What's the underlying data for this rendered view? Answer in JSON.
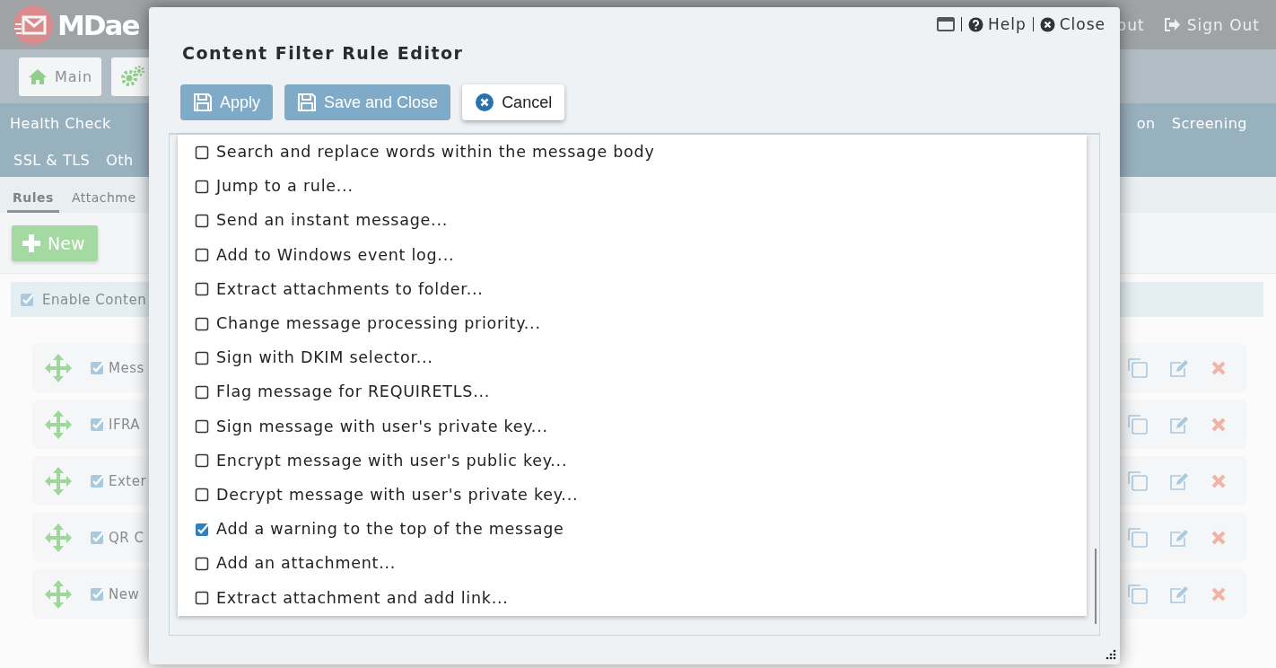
{
  "app_header": {
    "logo_text": "MDae",
    "links": [
      {
        "label": "out",
        "kind": "plain"
      },
      {
        "label": "Sign Out",
        "kind": "signout"
      }
    ]
  },
  "toolbar": {
    "buttons": [
      {
        "label": "Main",
        "kind": "home"
      },
      {
        "kind": "settings"
      }
    ]
  },
  "nav": {
    "rows": [
      {
        "left": [
          "Health Check"
        ],
        "right": [
          "on",
          "Screening"
        ]
      },
      {
        "left": [
          "SSL & TLS",
          "Oth"
        ],
        "right": []
      }
    ]
  },
  "subtabs": [
    {
      "label": "Rules",
      "selected": true
    },
    {
      "label": "Attachme",
      "selected": false
    }
  ],
  "new_button": "New",
  "enable_option": {
    "label": "Enable Conten",
    "checked": true
  },
  "rules": [
    {
      "name": "Mess",
      "enabled": true
    },
    {
      "name": "IFRA",
      "enabled": true
    },
    {
      "name": "Exter",
      "enabled": true
    },
    {
      "name": "QR C",
      "enabled": true
    },
    {
      "name": "New",
      "enabled": true
    }
  ],
  "dialog": {
    "title": "Content Filter Rule Editor",
    "header_links": [
      {
        "label": "Help",
        "kind": "help"
      },
      {
        "label": "Close",
        "kind": "close"
      }
    ],
    "buttons": [
      {
        "label": "Apply",
        "kind": "primary"
      },
      {
        "label": "Save and Close",
        "kind": "primary"
      },
      {
        "label": "Cancel",
        "kind": "secondary"
      }
    ],
    "actions": [
      {
        "label": "Search and replace words within the message body",
        "checked": false
      },
      {
        "label": "Jump to a rule...",
        "checked": false
      },
      {
        "label": "Send an instant message...",
        "checked": false
      },
      {
        "label": "Add to Windows event log...",
        "checked": false
      },
      {
        "label": "Extract attachments to folder...",
        "checked": false
      },
      {
        "label": "Change message processing priority...",
        "checked": false
      },
      {
        "label": "Sign with DKIM selector...",
        "checked": false
      },
      {
        "label": "Flag message for REQUIRETLS...",
        "checked": false
      },
      {
        "label": "Sign message with user's private key...",
        "checked": false
      },
      {
        "label": "Encrypt message with user's public key...",
        "checked": false
      },
      {
        "label": "Decrypt message with user's private key...",
        "checked": false
      },
      {
        "label": "Add a warning to the top of the message",
        "checked": true
      },
      {
        "label": "Add an attachment...",
        "checked": false
      },
      {
        "label": "Extract attachment and add link...",
        "checked": false
      }
    ]
  }
}
